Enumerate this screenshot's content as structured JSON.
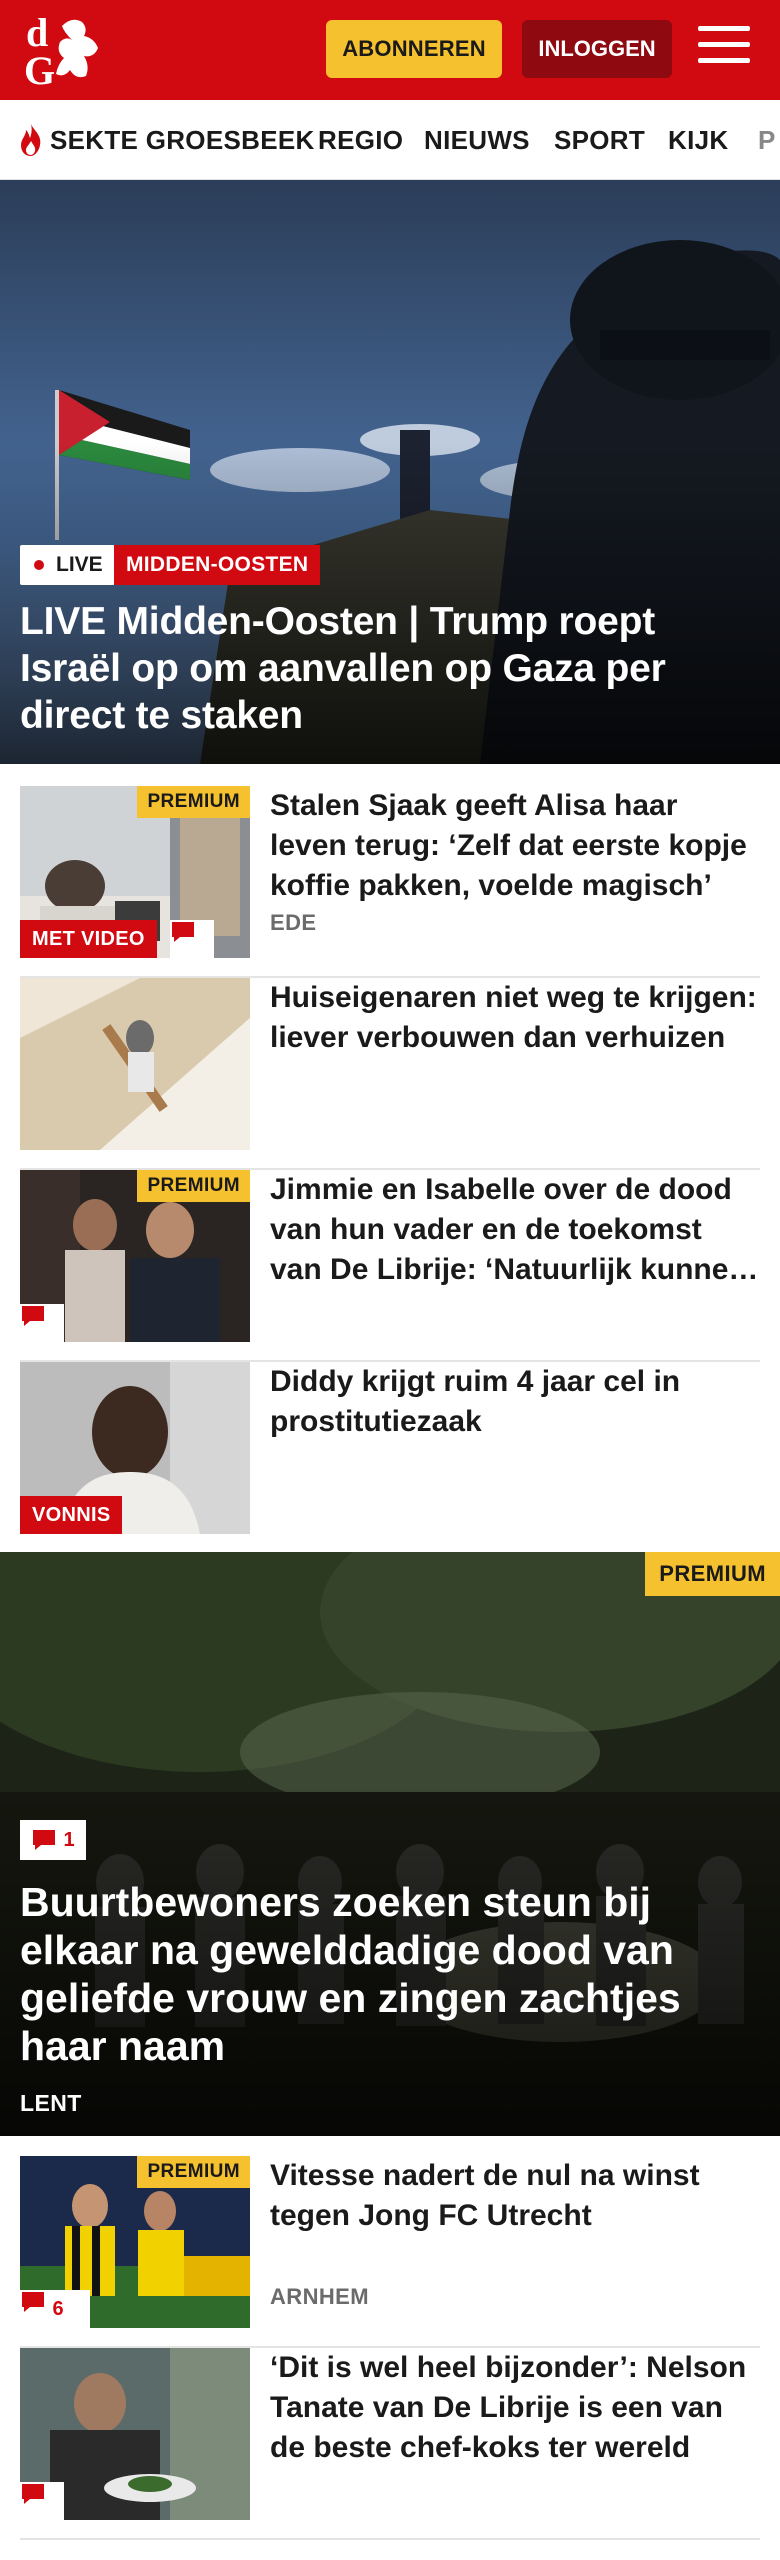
{
  "header": {
    "logo_text": "dG",
    "subscribe_label": "ABONNEREN",
    "login_label": "INLOGGEN",
    "brand_color": "#d10a11",
    "accent_color": "#f5c12e",
    "menu_icon": "hamburger-icon"
  },
  "nav": {
    "items": [
      {
        "label": "SEKTE GROESBEEK",
        "icon": "flame-icon"
      },
      {
        "label": "REGIO"
      },
      {
        "label": "NIEUWS"
      },
      {
        "label": "SPORT"
      },
      {
        "label": "KIJK"
      },
      {
        "label": "P"
      }
    ]
  },
  "hero": {
    "live_label": "LIVE",
    "section_label": "MIDDEN-OOSTEN",
    "title": "LIVE Midden-Oosten | Trump roept Israël op om aanvallen op Gaza per direct te staken"
  },
  "articles": [
    {
      "title": "Stalen Sjaak geeft Alisa haar leven terug: ‘Zelf dat eerste kopje koffie pakken, voelde magisch’",
      "meta": "EDE",
      "premium": "PREMIUM",
      "video_label": "MET VIDEO",
      "comment_icon": "comment-icon"
    },
    {
      "title": "Huiseigenaren niet weg te krijgen: liever verbouwen dan verhuizen"
    },
    {
      "title": "Jimmie en Isabelle over de dood van hun vader en de toekomst van De Librije: ‘Natuurlijk kunne…",
      "premium": "PREMIUM",
      "comment_icon": "comment-icon"
    },
    {
      "title": "Diddy krijgt ruim 4 jaar cel in prostitutiezaak",
      "tag_label": "VONNIS"
    }
  ],
  "feature": {
    "premium": "PREMIUM",
    "comment_count": "1",
    "title": "Buurtbewoners zoeken steun bij elkaar na gewelddadige dood van geliefde vrouw en zingen zachtjes haar naam",
    "meta": "LENT"
  },
  "articles2": [
    {
      "title": "Vitesse nadert de nul na winst tegen Jong FC Utrecht",
      "meta": "ARNHEM",
      "premium": "PREMIUM",
      "comment_count": "6"
    },
    {
      "title": "‘Dit is wel heel bijzonder’: Nelson Tanate van De Librije is een van de beste chef-koks ter wereld",
      "comment_icon": "comment-icon"
    }
  ]
}
